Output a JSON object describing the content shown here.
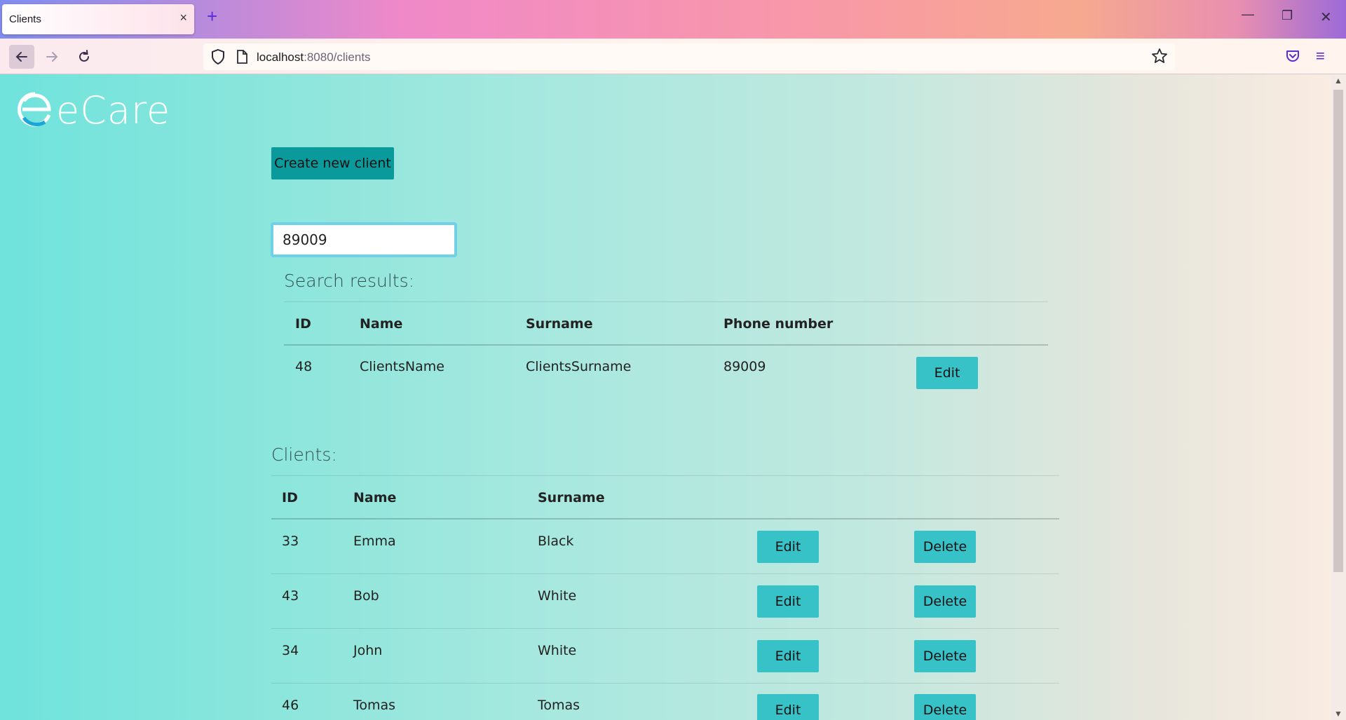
{
  "browser": {
    "tab_title": "Clients",
    "tab_close": "×",
    "new_tab": "+",
    "url_host": "localhost",
    "url_path": ":8080/clients",
    "win_min": "—",
    "win_max": "❐",
    "win_close": "✕",
    "menu": "≡"
  },
  "app": {
    "logo_text": "eCare",
    "create_button": "Create new client",
    "search_value": "89009"
  },
  "search_results": {
    "title": "Search results:",
    "headers": [
      "ID",
      "Name",
      "Surname",
      "Phone number"
    ],
    "rows": [
      {
        "id": "48",
        "name": "ClientsName",
        "surname": "ClientsSurname",
        "phone": "89009",
        "edit": "Edit"
      }
    ]
  },
  "clients": {
    "title": "Clients:",
    "headers": [
      "ID",
      "Name",
      "Surname"
    ],
    "rows": [
      {
        "id": "33",
        "name": "Emma",
        "surname": "Black",
        "edit": "Edit",
        "delete": "Delete"
      },
      {
        "id": "43",
        "name": "Bob",
        "surname": "White",
        "edit": "Edit",
        "delete": "Delete"
      },
      {
        "id": "34",
        "name": "John",
        "surname": "White",
        "edit": "Edit",
        "delete": "Delete"
      },
      {
        "id": "46",
        "name": "Tomas",
        "surname": "Tomas",
        "edit": "Edit",
        "delete": "Delete"
      }
    ]
  },
  "colors": {
    "create_button": "#0b9a9c",
    "row_button": "#37c2c8",
    "search_border": "#6fd0e8"
  }
}
